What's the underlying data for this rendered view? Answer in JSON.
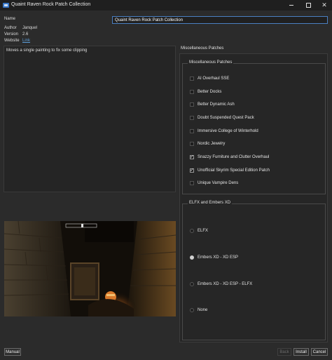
{
  "window": {
    "title": "Quaint Raven Rock Patch Collection"
  },
  "info": {
    "name_label": "Name",
    "name_value": "Quaint Raven Rock Patch Collection",
    "author_label": "Author",
    "author_value": "Janquel",
    "version_label": "Version",
    "version_value": "2.6",
    "website_label": "Website",
    "website_link": "Link"
  },
  "description": "Moves a single painting to fix some clipping",
  "panel": {
    "title": "Miscellaneous Patches",
    "group1": {
      "title": "Miscellaneous Patches",
      "items": [
        {
          "label": "AI Overhaul SSE",
          "checked": false
        },
        {
          "label": "Better Docks",
          "checked": false
        },
        {
          "label": "Better Dynamic Ash",
          "checked": false
        },
        {
          "label": "Doubt Suspended Quest Pack",
          "checked": false
        },
        {
          "label": "Immersive College of Winterhold",
          "checked": false
        },
        {
          "label": "Nordic Jewelry",
          "checked": false
        },
        {
          "label": "Snazzy Furniture and Clutter Overhaul",
          "checked": true
        },
        {
          "label": "Unofficial Skyrim Special Edition Patch",
          "checked": true
        },
        {
          "label": "Unique Vampire Dens",
          "checked": false
        }
      ]
    },
    "group2": {
      "title": "ELFX and Embers XD",
      "items": [
        {
          "label": "ELFX",
          "selected": false
        },
        {
          "label": "Embers XD - XD ESP",
          "selected": true
        },
        {
          "label": "Embers XD - XD ESP - ELFX",
          "selected": false
        },
        {
          "label": "None",
          "selected": false
        }
      ]
    }
  },
  "footer": {
    "manual_label": "Manual",
    "back_label": "Back",
    "install_label": "Install",
    "cancel_label": "Cancel"
  }
}
